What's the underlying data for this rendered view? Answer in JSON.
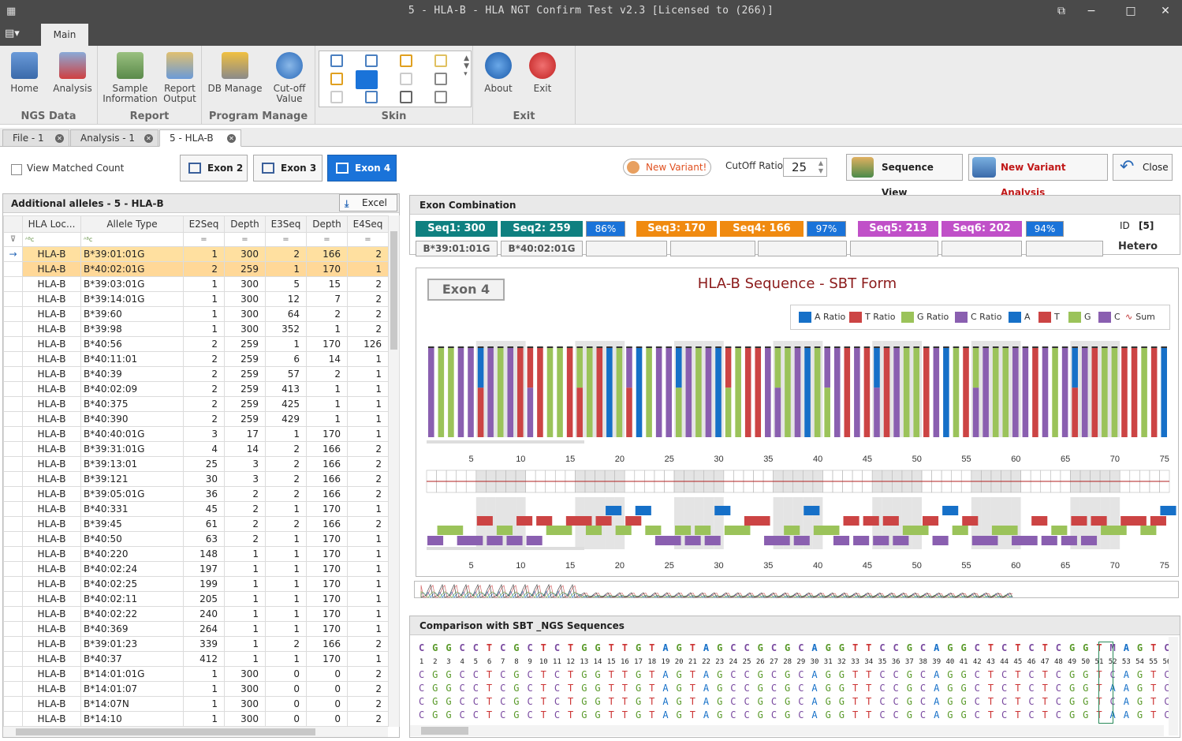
{
  "window": {
    "title": "5 - HLA-B - HLA NGT Confirm Test v2.3  [Licensed to          (266)]"
  },
  "ribbon": {
    "main_tab": "Main",
    "groups": [
      {
        "label": "NGS Data",
        "buttons": [
          "Home",
          "Analysis"
        ]
      },
      {
        "label": "Report",
        "buttons": [
          "Sample\nInformation",
          "Report\nOutput"
        ]
      },
      {
        "label": "Program Manage",
        "buttons": [
          "DB Manage",
          "Cut-off\nValue"
        ]
      },
      {
        "label": "Skin",
        "buttons": []
      },
      {
        "label": "Exit",
        "buttons": [
          "About",
          "Exit"
        ]
      }
    ],
    "home": "Home",
    "analysis": "Analysis",
    "sample_info": "Sample Information",
    "report_output": "Report Output",
    "db_manage": "DB Manage",
    "cutoff_value": "Cut-off Value",
    "about": "About",
    "exit": "Exit",
    "g_ngs": "NGS Data",
    "g_report": "Report",
    "g_program": "Program Manage",
    "g_skin": "Skin",
    "g_exit": "Exit"
  },
  "doc_tabs": [
    "File - 1",
    "Analysis - 1",
    "5 - HLA-B"
  ],
  "toolbar": {
    "view_matched": "View Matched Count",
    "exon2": "Exon 2",
    "exon3": "Exon 3",
    "exon4": "Exon 4",
    "new_variant_pill": "New Variant!",
    "cutoff_label": "CutOff Ratio",
    "cutoff_value": "25",
    "sequence_view": "Sequence View",
    "new_variant_analysis": "New Variant Analysis",
    "close": "Close"
  },
  "left_panel": {
    "title": "Additional alleles - 5 - HLA-B",
    "excel": "Excel",
    "columns": [
      "HLA Loc...",
      "Allele Type",
      "E2Seq",
      "Depth",
      "E3Seq",
      "Depth",
      "E4Seq",
      "D"
    ],
    "rows": [
      [
        "HLA-B",
        "B*39:01:01G",
        "1",
        "300",
        "2",
        "166",
        "2"
      ],
      [
        "HLA-B",
        "B*40:02:01G",
        "2",
        "259",
        "1",
        "170",
        "1"
      ],
      [
        "HLA-B",
        "B*39:03:01G",
        "1",
        "300",
        "5",
        "15",
        "2"
      ],
      [
        "HLA-B",
        "B*39:14:01G",
        "1",
        "300",
        "12",
        "7",
        "2"
      ],
      [
        "HLA-B",
        "B*39:60",
        "1",
        "300",
        "64",
        "2",
        "2"
      ],
      [
        "HLA-B",
        "B*39:98",
        "1",
        "300",
        "352",
        "1",
        "2"
      ],
      [
        "HLA-B",
        "B*40:56",
        "2",
        "259",
        "1",
        "170",
        "126"
      ],
      [
        "HLA-B",
        "B*40:11:01",
        "2",
        "259",
        "6",
        "14",
        "1"
      ],
      [
        "HLA-B",
        "B*40:39",
        "2",
        "259",
        "57",
        "2",
        "1"
      ],
      [
        "HLA-B",
        "B*40:02:09",
        "2",
        "259",
        "413",
        "1",
        "1"
      ],
      [
        "HLA-B",
        "B*40:375",
        "2",
        "259",
        "425",
        "1",
        "1"
      ],
      [
        "HLA-B",
        "B*40:390",
        "2",
        "259",
        "429",
        "1",
        "1"
      ],
      [
        "HLA-B",
        "B*40:40:01G",
        "3",
        "17",
        "1",
        "170",
        "1"
      ],
      [
        "HLA-B",
        "B*39:31:01G",
        "4",
        "14",
        "2",
        "166",
        "2"
      ],
      [
        "HLA-B",
        "B*39:13:01",
        "25",
        "3",
        "2",
        "166",
        "2"
      ],
      [
        "HLA-B",
        "B*39:121",
        "30",
        "3",
        "2",
        "166",
        "2"
      ],
      [
        "HLA-B",
        "B*39:05:01G",
        "36",
        "2",
        "2",
        "166",
        "2"
      ],
      [
        "HLA-B",
        "B*40:331",
        "45",
        "2",
        "1",
        "170",
        "1"
      ],
      [
        "HLA-B",
        "B*39:45",
        "61",
        "2",
        "2",
        "166",
        "2"
      ],
      [
        "HLA-B",
        "B*40:50",
        "63",
        "2",
        "1",
        "170",
        "1"
      ],
      [
        "HLA-B",
        "B*40:220",
        "148",
        "1",
        "1",
        "170",
        "1"
      ],
      [
        "HLA-B",
        "B*40:02:24",
        "197",
        "1",
        "1",
        "170",
        "1"
      ],
      [
        "HLA-B",
        "B*40:02:25",
        "199",
        "1",
        "1",
        "170",
        "1"
      ],
      [
        "HLA-B",
        "B*40:02:11",
        "205",
        "1",
        "1",
        "170",
        "1"
      ],
      [
        "HLA-B",
        "B*40:02:22",
        "240",
        "1",
        "1",
        "170",
        "1"
      ],
      [
        "HLA-B",
        "B*40:369",
        "264",
        "1",
        "1",
        "170",
        "1"
      ],
      [
        "HLA-B",
        "B*39:01:23",
        "339",
        "1",
        "2",
        "166",
        "2"
      ],
      [
        "HLA-B",
        "B*40:37",
        "412",
        "1",
        "1",
        "170",
        "1"
      ],
      [
        "HLA-B",
        "B*14:01:01G",
        "1",
        "300",
        "0",
        "0",
        "2"
      ],
      [
        "HLA-B",
        "B*14:01:07",
        "1",
        "300",
        "0",
        "0",
        "2"
      ],
      [
        "HLA-B",
        "B*14:07N",
        "1",
        "300",
        "0",
        "0",
        "2"
      ],
      [
        "HLA-B",
        "B*14:10",
        "1",
        "300",
        "0",
        "0",
        "2"
      ]
    ]
  },
  "exon_combination": {
    "title": "Exon Combination",
    "seqs": [
      {
        "label": "Seq1: 300",
        "color": "#0f8080"
      },
      {
        "label": "Seq2: 259",
        "color": "#0f8080"
      },
      {
        "label": "86%",
        "color": "#1a73d9"
      },
      {
        "label": "Seq3: 170",
        "color": "#f08a10"
      },
      {
        "label": "Seq4: 166",
        "color": "#f08a10"
      },
      {
        "label": "97%",
        "color": "#1a73d9"
      },
      {
        "label": "Seq5: 213",
        "color": "#c050c8"
      },
      {
        "label": "Seq6: 202",
        "color": "#c050c8"
      },
      {
        "label": "94%",
        "color": "#1a73d9"
      }
    ],
    "alleles": [
      "B*39:01:01G",
      "B*40:02:01G"
    ],
    "id_label": "ID",
    "id_value": "[5]",
    "zygosity": "Hetero"
  },
  "chart": {
    "exon_label": "Exon 4",
    "title": "HLA-B Sequence - SBT Form",
    "legend": [
      "A Ratio",
      "T Ratio",
      "G Ratio",
      "C Ratio",
      "A",
      "T",
      "G",
      "C",
      "Sum"
    ],
    "colors": {
      "A": "#1670c8",
      "T": "#cc4444",
      "G": "#9bc35a",
      "C": "#8a5fb0"
    },
    "x_ticks": [
      "5",
      "10",
      "15",
      "20",
      "25",
      "30",
      "35",
      "40",
      "45",
      "50",
      "55",
      "60",
      "65",
      "70",
      "75"
    ],
    "x_range": [
      1,
      75
    ]
  },
  "chart_data": {
    "type": "bar",
    "x": [
      1,
      75
    ],
    "series": [
      {
        "name": "A Ratio"
      },
      {
        "name": "T Ratio"
      },
      {
        "name": "G Ratio"
      },
      {
        "name": "C Ratio"
      }
    ],
    "bases": "CGGCCTCGCTCTGGTTGTAGTAGCCGCGCAGGTTCCGCAGGCTCTCTCGGTMAGTC"
  },
  "comparison": {
    "title": "Comparison with SBT _NGS Sequences",
    "consensus": "CGGCCTCGCTCTGGTTGTAGTAGCCGCGCAGGTTCCGCAGGCTCTCTCGGTMAGTC",
    "numbers": [
      "1",
      "2",
      "3",
      "4",
      "5",
      "6",
      "7",
      "8",
      "9",
      "10",
      "11",
      "12",
      "13",
      "14",
      "15",
      "16",
      "17",
      "18",
      "19",
      "20",
      "21",
      "22",
      "23",
      "24",
      "25",
      "26",
      "27",
      "28",
      "29",
      "30",
      "31",
      "32",
      "33",
      "34",
      "35",
      "36",
      "37",
      "38",
      "39",
      "40",
      "41",
      "42",
      "43",
      "44",
      "45",
      "46",
      "47",
      "48",
      "49",
      "50",
      "51",
      "52",
      "53",
      "54",
      "55",
      "56"
    ],
    "rows": [
      "CGGCCTCGCTCTGGTTGTAGTAGCCGCGCAGGTTCCGCAGGCTCTCTCGGTCAGTC",
      "CGGCCTCGCTCTGGTTGTAGTAGCCGCGCAGGTTCCGCAGGCTCTCTCGGTAAGTC",
      "CGGCCTCGCTCTGGTTGTAGTAGCCGCGCAGGTTCCGCAGGCTCTCTCGGTCAGTC",
      "CGGCCTCGCTCTGGTTGTAGTAGCCGCGCAGGTTCCGCAGGCTCTCTCGGTAAGTC"
    ]
  }
}
